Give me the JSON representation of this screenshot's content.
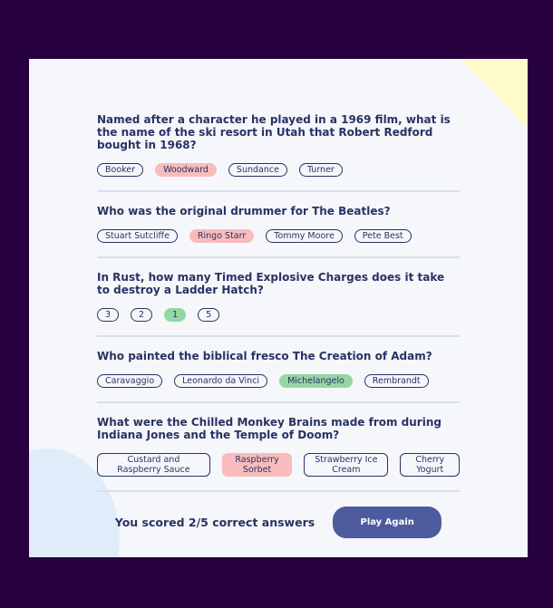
{
  "questions": [
    {
      "text": "Named after a character he played in a 1969 film, what is the name of the ski resort in Utah that Robert Redford bought in 1968?",
      "answers": [
        {
          "label": "Booker",
          "state": "none"
        },
        {
          "label": "Woodward",
          "state": "wrong"
        },
        {
          "label": "Sundance",
          "state": "none"
        },
        {
          "label": "Turner",
          "state": "none"
        }
      ]
    },
    {
      "text": "Who was the original drummer for The Beatles?",
      "answers": [
        {
          "label": "Stuart Sutcliffe",
          "state": "none"
        },
        {
          "label": "Ringo Starr",
          "state": "wrong"
        },
        {
          "label": "Tommy Moore",
          "state": "none"
        },
        {
          "label": "Pete Best",
          "state": "none"
        }
      ]
    },
    {
      "text": "In Rust, how many Timed Explosive Charges does it take to destroy a Ladder Hatch?",
      "answers": [
        {
          "label": "3",
          "state": "none"
        },
        {
          "label": "2",
          "state": "none"
        },
        {
          "label": "1",
          "state": "correct"
        },
        {
          "label": "5",
          "state": "none"
        }
      ]
    },
    {
      "text": "Who painted the biblical fresco The Creation of Adam?",
      "answers": [
        {
          "label": "Caravaggio",
          "state": "none"
        },
        {
          "label": "Leonardo da Vinci",
          "state": "none"
        },
        {
          "label": "Michelangelo",
          "state": "correct"
        },
        {
          "label": "Rembrandt",
          "state": "none"
        }
      ]
    },
    {
      "text": "What were the Chilled Monkey Brains made from during Indiana Jones and the Temple of Doom?",
      "answers": [
        {
          "label": "Custard and Raspberry Sauce",
          "state": "none"
        },
        {
          "label": "Raspberry Sorbet",
          "state": "wrong"
        },
        {
          "label": "Strawberry Ice Cream",
          "state": "none"
        },
        {
          "label": "Cherry Yogurt",
          "state": "none"
        }
      ]
    }
  ],
  "footer": {
    "score_text": "You scored 2/5 correct answers",
    "play_again_label": "Play Again"
  },
  "colors": {
    "background": "#27003f",
    "card": "#f5f7fb",
    "text": "#293264",
    "wrong": "#f8bcbc",
    "correct": "#94d7a2",
    "button": "#4d5b9e"
  }
}
